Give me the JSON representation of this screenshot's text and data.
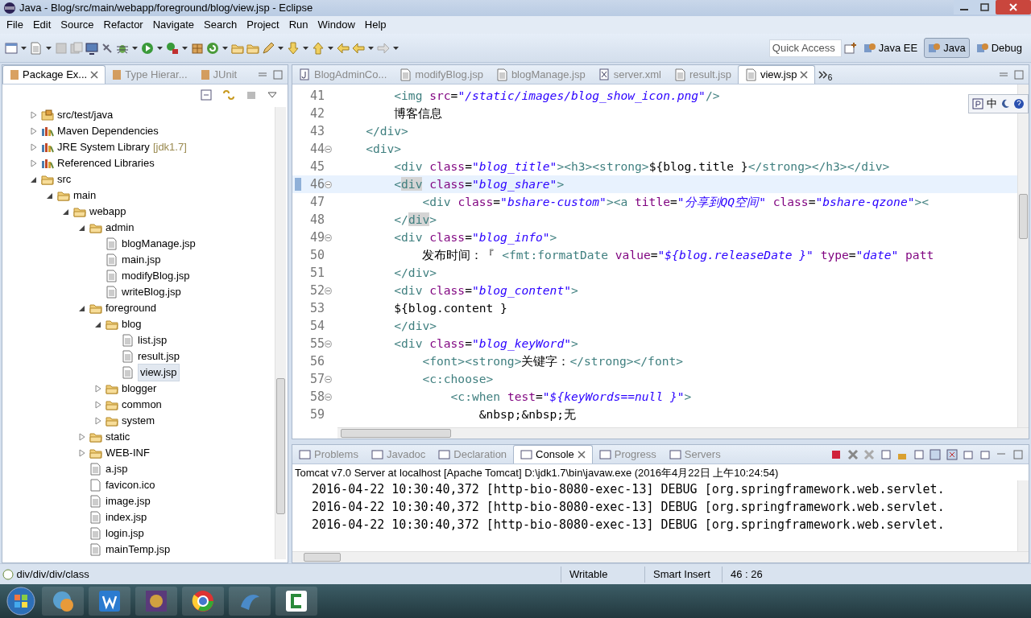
{
  "window": {
    "title": "Java - Blog/src/main/webapp/foreground/blog/view.jsp - Eclipse"
  },
  "menu": [
    "File",
    "Edit",
    "Source",
    "Refactor",
    "Navigate",
    "Search",
    "Project",
    "Run",
    "Window",
    "Help"
  ],
  "quick_access": {
    "placeholder": "Quick Access"
  },
  "perspectives": [
    {
      "label": "Java EE",
      "selected": false
    },
    {
      "label": "Java",
      "selected": true
    },
    {
      "label": "Debug",
      "selected": false
    }
  ],
  "explorer": {
    "tabs": [
      {
        "label": "Package Ex...",
        "selected": true
      },
      {
        "label": "Type Hierar...",
        "selected": false
      },
      {
        "label": "JUnit",
        "selected": false
      }
    ],
    "tree": [
      {
        "label": "src/test/java",
        "kind": "source-folder",
        "expanded": false,
        "selected": false
      },
      {
        "label": "Maven Dependencies",
        "kind": "library",
        "expanded": false,
        "selected": false
      },
      {
        "label": "JRE System Library",
        "suffix": "[jdk1.7]",
        "kind": "library",
        "expanded": false,
        "selected": false
      },
      {
        "label": "Referenced Libraries",
        "kind": "library",
        "expanded": false,
        "selected": false
      },
      {
        "label": "src",
        "kind": "folder",
        "expanded": true,
        "selected": false,
        "children": [
          {
            "label": "main",
            "kind": "folder",
            "expanded": true,
            "selected": false,
            "children": [
              {
                "label": "webapp",
                "kind": "folder",
                "expanded": true,
                "selected": false,
                "children": [
                  {
                    "label": "admin",
                    "kind": "folder",
                    "expanded": true,
                    "selected": false,
                    "children": [
                      {
                        "label": "blogManage.jsp",
                        "kind": "file",
                        "selected": false
                      },
                      {
                        "label": "main.jsp",
                        "kind": "file",
                        "selected": false
                      },
                      {
                        "label": "modifyBlog.jsp",
                        "kind": "file",
                        "selected": false
                      },
                      {
                        "label": "writeBlog.jsp",
                        "kind": "file",
                        "selected": false
                      }
                    ]
                  },
                  {
                    "label": "foreground",
                    "kind": "folder",
                    "expanded": true,
                    "selected": false,
                    "children": [
                      {
                        "label": "blog",
                        "kind": "folder",
                        "expanded": true,
                        "selected": false,
                        "children": [
                          {
                            "label": "list.jsp",
                            "kind": "file",
                            "selected": false
                          },
                          {
                            "label": "result.jsp",
                            "kind": "file",
                            "selected": false
                          },
                          {
                            "label": "view.jsp",
                            "kind": "file",
                            "selected": true
                          }
                        ]
                      },
                      {
                        "label": "blogger",
                        "kind": "folder",
                        "expanded": false,
                        "selected": false
                      },
                      {
                        "label": "common",
                        "kind": "folder",
                        "expanded": false,
                        "selected": false
                      },
                      {
                        "label": "system",
                        "kind": "folder",
                        "expanded": false,
                        "selected": false
                      }
                    ]
                  },
                  {
                    "label": "static",
                    "kind": "folder",
                    "expanded": false,
                    "selected": false
                  },
                  {
                    "label": "WEB-INF",
                    "kind": "folder",
                    "expanded": false,
                    "selected": false
                  },
                  {
                    "label": "a.jsp",
                    "kind": "file",
                    "selected": false
                  },
                  {
                    "label": "favicon.ico",
                    "kind": "blank-file",
                    "selected": false
                  },
                  {
                    "label": "image.jsp",
                    "kind": "file",
                    "selected": false
                  },
                  {
                    "label": "index.jsp",
                    "kind": "file",
                    "selected": false
                  },
                  {
                    "label": "login.jsp",
                    "kind": "file",
                    "selected": false
                  },
                  {
                    "label": "mainTemp.jsp",
                    "kind": "file",
                    "selected": false
                  }
                ]
              }
            ]
          }
        ]
      }
    ]
  },
  "editor": {
    "tabs": [
      {
        "label": "BlogAdminCo...",
        "kind": "java",
        "selected": false
      },
      {
        "label": "modifyBlog.jsp",
        "kind": "file",
        "selected": false
      },
      {
        "label": "blogManage.jsp",
        "kind": "file",
        "selected": false
      },
      {
        "label": "server.xml",
        "kind": "xml",
        "selected": false
      },
      {
        "label": "result.jsp",
        "kind": "file",
        "selected": false
      },
      {
        "label": "view.jsp",
        "kind": "file",
        "selected": true
      }
    ],
    "hidden_tabs": "6",
    "ime": "中",
    "lines": [
      {
        "number": "41",
        "foldable": false,
        "current": false,
        "tokens": [
          {
            "kind": "tag",
            "text": "        <img"
          },
          {
            "kind": "attr",
            "text": " src"
          },
          {
            "kind": "text",
            "text": "="
          },
          {
            "kind": "str",
            "text": "\"/static/images/blog_show_icon.png\""
          },
          {
            "kind": "tag",
            "text": "/>"
          }
        ]
      },
      {
        "number": "42",
        "foldable": false,
        "current": false,
        "tokens": [
          {
            "kind": "text",
            "text": "        博客信息"
          }
        ]
      },
      {
        "number": "43",
        "foldable": false,
        "current": false,
        "tokens": [
          {
            "kind": "tag",
            "text": "    </div>"
          }
        ]
      },
      {
        "number": "44",
        "foldable": true,
        "current": false,
        "tokens": [
          {
            "kind": "tag",
            "text": "    <div>"
          }
        ]
      },
      {
        "number": "45",
        "foldable": false,
        "current": false,
        "tokens": [
          {
            "kind": "tag",
            "text": "        <div"
          },
          {
            "kind": "attr",
            "text": " class"
          },
          {
            "kind": "text",
            "text": "="
          },
          {
            "kind": "str",
            "text": "\"blog_title\""
          },
          {
            "kind": "tag",
            "text": "><h3><strong>"
          },
          {
            "kind": "text",
            "text": "${blog.title }"
          },
          {
            "kind": "tag",
            "text": "</strong></h3></div>"
          }
        ]
      },
      {
        "number": "46",
        "foldable": true,
        "current": true,
        "tokens": [
          {
            "kind": "tag",
            "text": "        <"
          },
          {
            "kind": "match",
            "text": "div"
          },
          {
            "kind": "attr",
            "text": " class"
          },
          {
            "kind": "text",
            "text": "="
          },
          {
            "kind": "str",
            "text": "\"blog_share\""
          },
          {
            "kind": "tag",
            "text": ">"
          }
        ]
      },
      {
        "number": "47",
        "foldable": false,
        "current": false,
        "tokens": [
          {
            "kind": "tag",
            "text": "            <div"
          },
          {
            "kind": "attr",
            "text": " class"
          },
          {
            "kind": "text",
            "text": "="
          },
          {
            "kind": "str",
            "text": "\"bshare-custom\""
          },
          {
            "kind": "tag",
            "text": "><a"
          },
          {
            "kind": "attr",
            "text": " title"
          },
          {
            "kind": "text",
            "text": "="
          },
          {
            "kind": "str",
            "text": "\"分享到QQ空间\""
          },
          {
            "kind": "attr",
            "text": " class"
          },
          {
            "kind": "text",
            "text": "="
          },
          {
            "kind": "str",
            "text": "\"bshare-qzone\""
          },
          {
            "kind": "tag",
            "text": "><"
          }
        ]
      },
      {
        "number": "48",
        "foldable": false,
        "current": false,
        "tokens": [
          {
            "kind": "tag",
            "text": "        </"
          },
          {
            "kind": "match",
            "text": "div"
          },
          {
            "kind": "tag",
            "text": ">"
          }
        ]
      },
      {
        "number": "49",
        "foldable": true,
        "current": false,
        "tokens": [
          {
            "kind": "tag",
            "text": "        <div"
          },
          {
            "kind": "attr",
            "text": " class"
          },
          {
            "kind": "text",
            "text": "="
          },
          {
            "kind": "str",
            "text": "\"blog_info\""
          },
          {
            "kind": "tag",
            "text": ">"
          }
        ]
      },
      {
        "number": "50",
        "foldable": false,
        "current": false,
        "tokens": [
          {
            "kind": "text",
            "text": "            发布时间：『 "
          },
          {
            "kind": "tag",
            "text": "<fmt:formatDate"
          },
          {
            "kind": "attr",
            "text": " value"
          },
          {
            "kind": "text",
            "text": "="
          },
          {
            "kind": "str",
            "text": "\"${blog.releaseDate }\""
          },
          {
            "kind": "attr",
            "text": " type"
          },
          {
            "kind": "text",
            "text": "="
          },
          {
            "kind": "str",
            "text": "\"date\""
          },
          {
            "kind": "attr",
            "text": " patt"
          }
        ]
      },
      {
        "number": "51",
        "foldable": false,
        "current": false,
        "tokens": [
          {
            "kind": "tag",
            "text": "        </div>"
          }
        ]
      },
      {
        "number": "52",
        "foldable": true,
        "current": false,
        "tokens": [
          {
            "kind": "tag",
            "text": "        <div"
          },
          {
            "kind": "attr",
            "text": " class"
          },
          {
            "kind": "text",
            "text": "="
          },
          {
            "kind": "str",
            "text": "\"blog_content\""
          },
          {
            "kind": "tag",
            "text": ">"
          }
        ]
      },
      {
        "number": "53",
        "foldable": false,
        "current": false,
        "tokens": [
          {
            "kind": "text",
            "text": "        ${blog.content }"
          }
        ]
      },
      {
        "number": "54",
        "foldable": false,
        "current": false,
        "tokens": [
          {
            "kind": "tag",
            "text": "        </div>"
          }
        ]
      },
      {
        "number": "55",
        "foldable": true,
        "current": false,
        "tokens": [
          {
            "kind": "tag",
            "text": "        <div"
          },
          {
            "kind": "attr",
            "text": " class"
          },
          {
            "kind": "text",
            "text": "="
          },
          {
            "kind": "str",
            "text": "\"blog_keyWord\""
          },
          {
            "kind": "tag",
            "text": ">"
          }
        ]
      },
      {
        "number": "56",
        "foldable": false,
        "current": false,
        "tokens": [
          {
            "kind": "tag",
            "text": "            <font><strong>"
          },
          {
            "kind": "text",
            "text": "关键字："
          },
          {
            "kind": "tag",
            "text": "</strong></font>"
          }
        ]
      },
      {
        "number": "57",
        "foldable": true,
        "current": false,
        "tokens": [
          {
            "kind": "tag",
            "text": "            <c:choose>"
          }
        ]
      },
      {
        "number": "58",
        "foldable": true,
        "current": false,
        "tokens": [
          {
            "kind": "tag",
            "text": "                <c:when"
          },
          {
            "kind": "attr",
            "text": " test"
          },
          {
            "kind": "text",
            "text": "="
          },
          {
            "kind": "str",
            "text": "\"${keyWords==null }\""
          },
          {
            "kind": "tag",
            "text": ">"
          }
        ]
      },
      {
        "number": "59",
        "foldable": false,
        "current": false,
        "tokens": [
          {
            "kind": "text",
            "text": "                    &nbsp;&nbsp;无"
          }
        ]
      }
    ]
  },
  "console": {
    "tabs": [
      {
        "label": "Problems",
        "selected": false
      },
      {
        "label": "Javadoc",
        "selected": false
      },
      {
        "label": "Declaration",
        "selected": false
      },
      {
        "label": "Console",
        "selected": true
      },
      {
        "label": "Progress",
        "selected": false
      },
      {
        "label": "Servers",
        "selected": false
      }
    ],
    "header": "Tomcat v7.0 Server at localhost [Apache Tomcat] D:\\jdk1.7\\bin\\javaw.exe (2016年4月22日 上午10:24:54)",
    "lines": [
      "2016-04-22 10:30:40,372 [http-bio-8080-exec-13] DEBUG [org.springframework.web.servlet.",
      "2016-04-22 10:30:40,372 [http-bio-8080-exec-13] DEBUG [org.springframework.web.servlet.",
      "2016-04-22 10:30:40,372 [http-bio-8080-exec-13] DEBUG [org.springframework.web.servlet."
    ]
  },
  "status_bar": {
    "path": "div/div/div/class",
    "mode": "Writable",
    "insert": "Smart Insert",
    "position": "46 : 26"
  }
}
